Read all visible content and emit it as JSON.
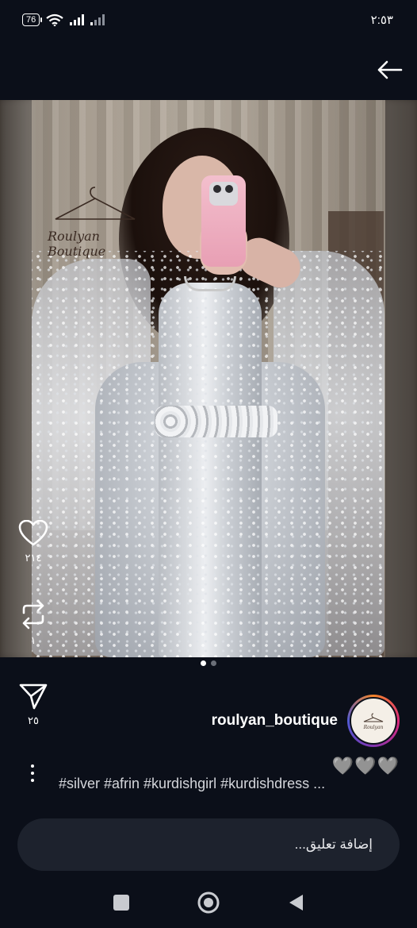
{
  "status_bar": {
    "battery": "76",
    "time": "٢:٥٣"
  },
  "post": {
    "username": "roulyan_boutique",
    "watermark": "Roulyan Boutique",
    "likes": "٢١٤",
    "reposts": "١",
    "shares": "٢٥",
    "reactions": "🩶🩶🩶",
    "caption": "#silver #afrin #kurdishgirl #kurdishdress ...",
    "carousel": {
      "count": 2,
      "active_index": 0
    }
  },
  "comment": {
    "placeholder": "إضافة تعليق..."
  },
  "colors": {
    "background": "#0b0f19",
    "comment_bg": "#1d222d",
    "accent": "#ffffff"
  }
}
